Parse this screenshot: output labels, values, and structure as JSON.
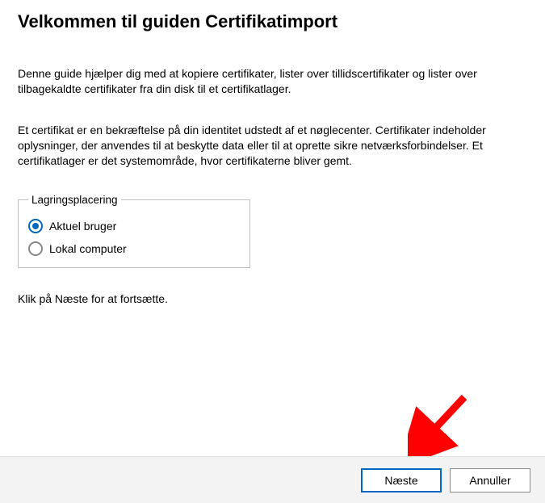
{
  "title": "Velkommen til guiden Certifikatimport",
  "intro": "Denne guide hjælper dig med at kopiere certifikater, lister over tillidscertifikater og lister over tilbagekaldte certifikater fra din disk til et certifikatlager.",
  "explain": "Et certifikat er en bekræftelse på din identitet udstedt af et nøglecenter. Certifikater indeholder oplysninger, der anvendes til at beskytte data eller til at oprette sikre netværksforbindelser. Et certifikatlager er det systemområde, hvor certifikaterne bliver gemt.",
  "storage": {
    "legend": "Lagringsplacering",
    "options": [
      {
        "label": "Aktuel bruger",
        "checked": true
      },
      {
        "label": "Lokal computer",
        "checked": false
      }
    ]
  },
  "continue_hint": "Klik på Næste for at fortsætte.",
  "buttons": {
    "next": "Næste",
    "cancel": "Annuller"
  },
  "annotation": {
    "arrow_color": "#ff0000"
  }
}
